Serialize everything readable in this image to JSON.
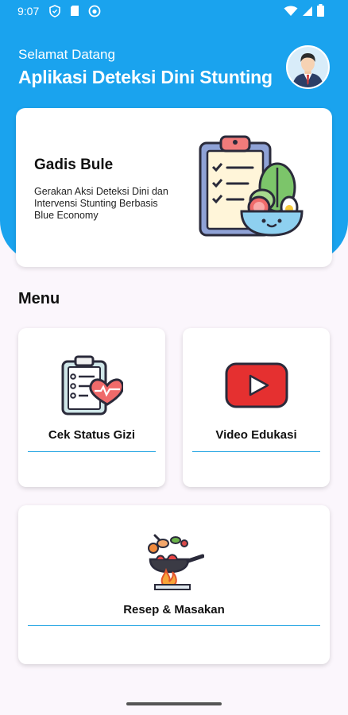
{
  "status_bar": {
    "time": "9:07",
    "left_icons": [
      "shield-icon",
      "sd-card-icon",
      "circle-app-icon"
    ],
    "right_icons": [
      "wifi-icon",
      "signal-icon",
      "battery-icon"
    ]
  },
  "header": {
    "welcome": "Selamat Datang",
    "title": "Aplikasi Deteksi Dini Stunting",
    "avatar_icon": "businessman-avatar-icon",
    "background_color": "#1aa3ee"
  },
  "hero": {
    "title": "Gadis Bule",
    "description": "Gerakan Aksi Deteksi Dini dan Intervensi Stunting Berbasis Blue Economy",
    "illustration": "clipboard-salad-bowl-icon"
  },
  "menu": {
    "heading": "Menu",
    "items": [
      {
        "label": "Cek Status Gizi",
        "icon": "clipboard-heart-icon"
      },
      {
        "label": "Video Edukasi",
        "icon": "youtube-play-icon"
      },
      {
        "label": "Resep & Masakan",
        "icon": "cooking-pan-icon"
      }
    ],
    "accent_color": "#29a7e3"
  }
}
